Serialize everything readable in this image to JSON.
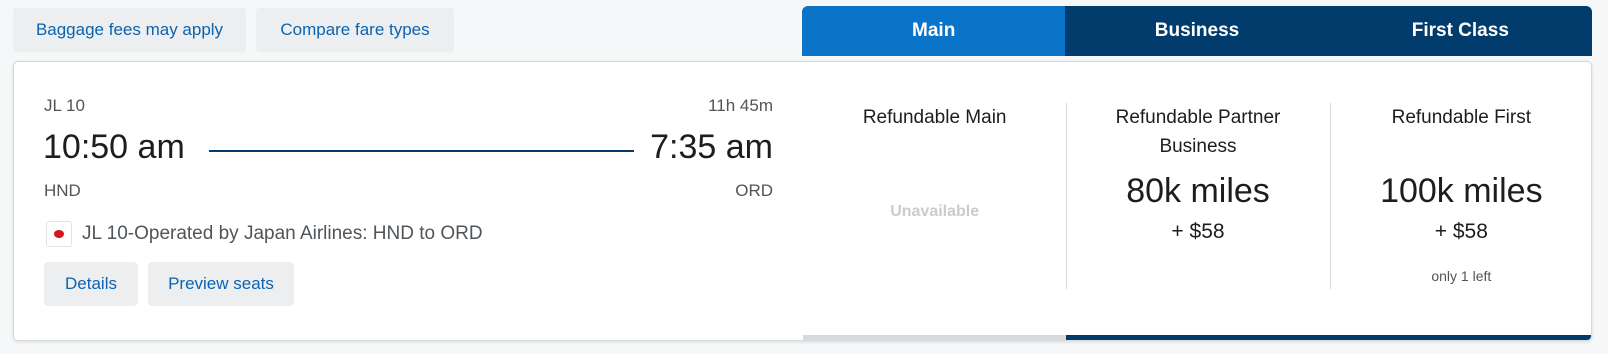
{
  "top_buttons": {
    "baggage": "Baggage fees may apply",
    "compare": "Compare fare types"
  },
  "tabs": [
    {
      "label": "Main",
      "active": true
    },
    {
      "label": "Business",
      "active": false
    },
    {
      "label": "First Class",
      "active": false
    }
  ],
  "flight": {
    "number": "JL 10",
    "duration": "11h 45m",
    "depart_time": "10:50 am",
    "arrive_time": "7:35 am",
    "depart_airport": "HND",
    "arrive_airport": "ORD",
    "carrier_text": "JL 10-Operated by Japan Airlines: HND to ORD",
    "carrier_icon": "japan-airlines-logo-icon",
    "details_label": "Details",
    "preview_seats_label": "Preview seats"
  },
  "fares": [
    {
      "name": "Refundable Main",
      "status": "Unavailable"
    },
    {
      "name": "Refundable Partner Business",
      "miles": "80k miles",
      "fee": "+ $58"
    },
    {
      "name": "Refundable First",
      "miles": "100k miles",
      "fee": "+ $58",
      "note": "only 1 left"
    }
  ],
  "colors": {
    "accent_blue": "#0a74c9",
    "navy": "#013c6c",
    "link_blue": "#0c63b0"
  }
}
